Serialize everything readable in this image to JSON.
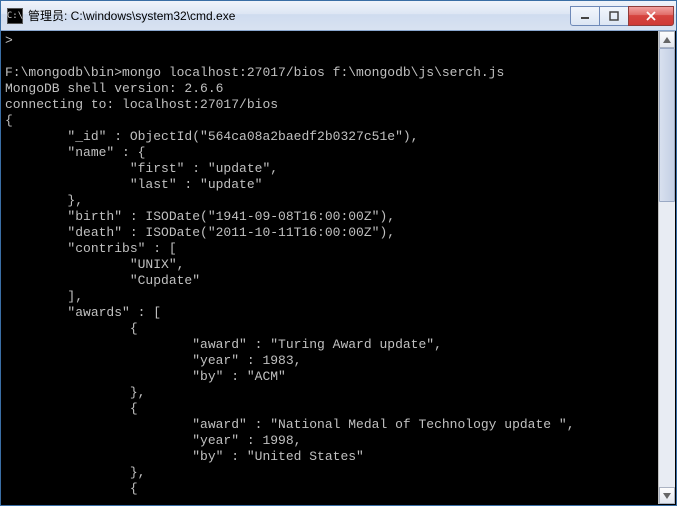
{
  "window": {
    "title": "管理员: C:\\windows\\system32\\cmd.exe",
    "icon_label": "C:\\"
  },
  "terminal": {
    "lines": [
      ">",
      "",
      "F:\\mongodb\\bin>mongo localhost:27017/bios f:\\mongodb\\js\\serch.js",
      "MongoDB shell version: 2.6.6",
      "connecting to: localhost:27017/bios",
      "{",
      "        \"_id\" : ObjectId(\"564ca08a2baedf2b0327c51e\"),",
      "        \"name\" : {",
      "                \"first\" : \"update\",",
      "                \"last\" : \"update\"",
      "        },",
      "        \"birth\" : ISODate(\"1941-09-08T16:00:00Z\"),",
      "        \"death\" : ISODate(\"2011-10-11T16:00:00Z\"),",
      "        \"contribs\" : [",
      "                \"UNIX\",",
      "                \"Cupdate\"",
      "        ],",
      "        \"awards\" : [",
      "                {",
      "                        \"award\" : \"Turing Award update\",",
      "                        \"year\" : 1983,",
      "                        \"by\" : \"ACM\"",
      "                },",
      "                {",
      "                        \"award\" : \"National Medal of Technology update \",",
      "                        \"year\" : 1998,",
      "                        \"by\" : \"United States\"",
      "                },",
      "                {"
    ]
  }
}
